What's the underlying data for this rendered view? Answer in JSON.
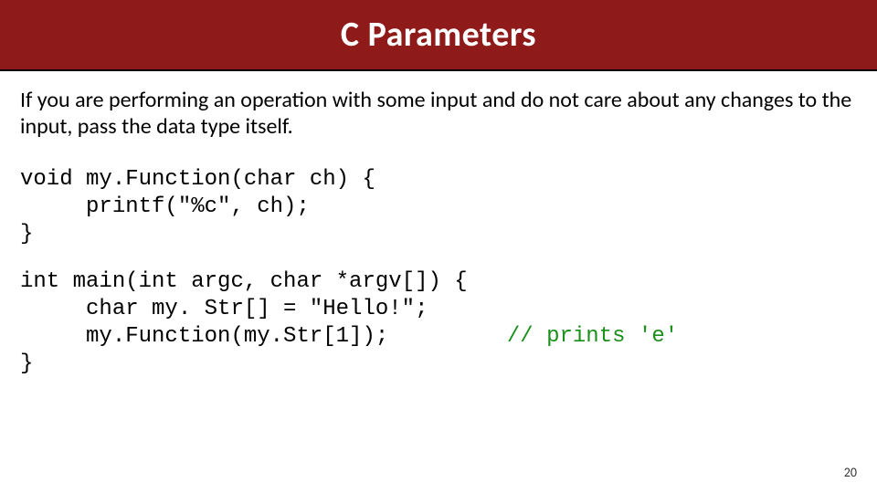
{
  "slide": {
    "title": "C Parameters",
    "page_number": "20",
    "explanation": "If you are performing an operation with some input and do not care about any changes to the input, pass the data type itself.",
    "code_block_1": "void my.Function(char ch) {\n     printf(\"%c\", ch);\n}",
    "code_block_2_pre": "int main(int argc, char *argv[]) {\n     char my. Str[] = \"Hello!\";\n     my.Function(my.Str[1]);         ",
    "code_block_2_comment": "// prints 'e'",
    "code_block_2_post": "\n}"
  }
}
